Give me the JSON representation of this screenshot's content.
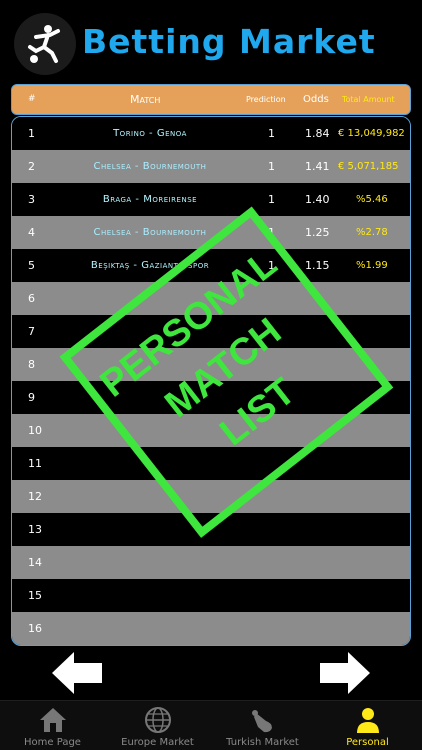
{
  "app": {
    "title": "Betting Market"
  },
  "columns": {
    "num": "#",
    "match": "Match",
    "prediction": "Prediction",
    "odds": "Odds",
    "total": "Total Amount"
  },
  "rows": [
    {
      "num": "1",
      "match": "Torino - Genoa",
      "prediction": "1",
      "odds": "1.84",
      "total": "€ 13,049,982"
    },
    {
      "num": "2",
      "match": "Chelsea - Bournemouth",
      "prediction": "1",
      "odds": "1.41",
      "total": "€ 5,071,185"
    },
    {
      "num": "3",
      "match": "Braga - Moreirense",
      "prediction": "1",
      "odds": "1.40",
      "total": "%5.46"
    },
    {
      "num": "4",
      "match": "Chelsea - Bournemouth",
      "prediction": "1",
      "odds": "1.25",
      "total": "%2.78"
    },
    {
      "num": "5",
      "match": "Beşiktaş - Gaziantepspor",
      "prediction": "1",
      "odds": "1.15",
      "total": "%1.99"
    },
    {
      "num": "6",
      "match": "",
      "prediction": "",
      "odds": "",
      "total": ""
    },
    {
      "num": "7",
      "match": "",
      "prediction": "",
      "odds": "",
      "total": ""
    },
    {
      "num": "8",
      "match": "",
      "prediction": "",
      "odds": "",
      "total": ""
    },
    {
      "num": "9",
      "match": "",
      "prediction": "",
      "odds": "",
      "total": ""
    },
    {
      "num": "10",
      "match": "",
      "prediction": "",
      "odds": "",
      "total": ""
    },
    {
      "num": "11",
      "match": "",
      "prediction": "",
      "odds": "",
      "total": ""
    },
    {
      "num": "12",
      "match": "",
      "prediction": "",
      "odds": "",
      "total": ""
    },
    {
      "num": "13",
      "match": "",
      "prediction": "",
      "odds": "",
      "total": ""
    },
    {
      "num": "14",
      "match": "",
      "prediction": "",
      "odds": "",
      "total": ""
    },
    {
      "num": "15",
      "match": "",
      "prediction": "",
      "odds": "",
      "total": ""
    },
    {
      "num": "16",
      "match": "",
      "prediction": "",
      "odds": "",
      "total": ""
    }
  ],
  "stamp": {
    "line1": "PERSONAL",
    "line2": "MATCH",
    "line3": "LIST",
    "color": "#3ee63e"
  },
  "tabs": [
    {
      "label": "Home Page",
      "icon": "home-icon"
    },
    {
      "label": "Europe Market",
      "icon": "globe-icon"
    },
    {
      "label": "Turkish Market",
      "icon": "hand-icon"
    },
    {
      "label": "Personal",
      "icon": "person-icon",
      "active": true
    }
  ],
  "colors": {
    "accent": "#1fa8ee",
    "header_bg": "#e5a15a",
    "gold": "#ffe818",
    "row_alt": "#8c8c8c"
  }
}
